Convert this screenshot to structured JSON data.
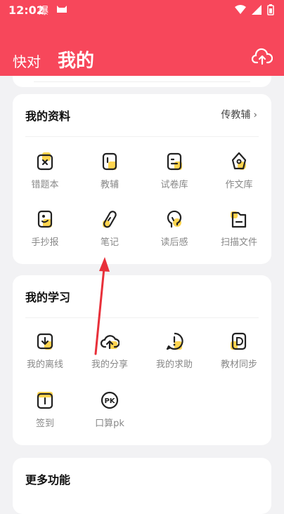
{
  "status_bar": {
    "time": "12:02",
    "app_icon_1": "爆",
    "icons": [
      "cat-icon",
      "wifi-icon",
      "signal-icon",
      "battery-icon"
    ]
  },
  "header": {
    "tab_kuaidui": "快对",
    "tab_mine": "我的",
    "upload_icon": "cloud-upload-icon",
    "color": "#f7475b"
  },
  "my_materials": {
    "title": "我的资料",
    "link": "传教辅",
    "items": [
      {
        "label": "错题本",
        "icon": "wrong-questions-icon"
      },
      {
        "label": "教辅",
        "icon": "book-icon"
      },
      {
        "label": "试卷库",
        "icon": "paper-icon"
      },
      {
        "label": "作文库",
        "icon": "pen-nib-icon"
      },
      {
        "label": "手抄报",
        "icon": "newspaper-icon"
      },
      {
        "label": "笔记",
        "icon": "pencil-icon"
      },
      {
        "label": "读后感",
        "icon": "lightbulb-icon"
      },
      {
        "label": "扫描文件",
        "icon": "folder-icon"
      }
    ]
  },
  "my_study": {
    "title": "我的学习",
    "items": [
      {
        "label": "我的离线",
        "icon": "download-icon"
      },
      {
        "label": "我的分享",
        "icon": "cloud-share-icon"
      },
      {
        "label": "我的求助",
        "icon": "help-icon"
      },
      {
        "label": "教材同步",
        "icon": "textbook-icon"
      },
      {
        "label": "签到",
        "icon": "checkin-icon"
      },
      {
        "label": "口算pk",
        "icon": "pk-icon"
      }
    ]
  },
  "more": {
    "title": "更多功能"
  },
  "accent_yellow": "#ffd54f"
}
